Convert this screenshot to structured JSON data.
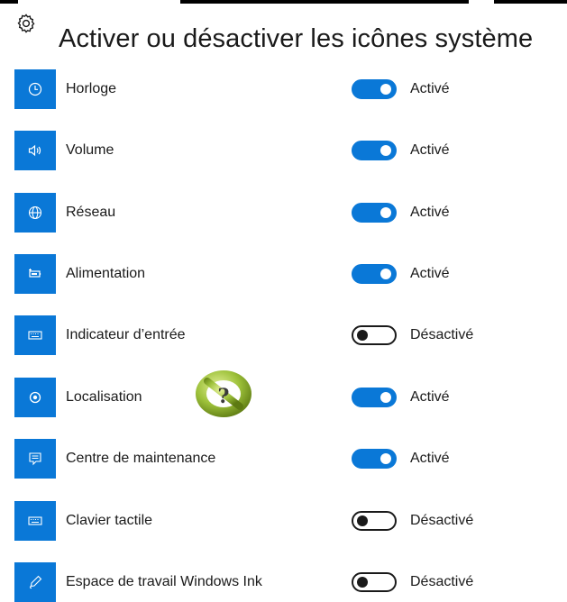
{
  "header": {
    "title": "Activer ou désactiver les icônes système",
    "icon": "gear-icon"
  },
  "items": [
    {
      "label": "Horloge",
      "icon": "clock-icon",
      "state_label": "Activé",
      "on": true
    },
    {
      "label": "Volume",
      "icon": "speaker-icon",
      "state_label": "Activé",
      "on": true
    },
    {
      "label": "Réseau",
      "icon": "globe-icon",
      "state_label": "Activé",
      "on": true
    },
    {
      "label": "Alimentation",
      "icon": "battery-icon",
      "state_label": "Activé",
      "on": true
    },
    {
      "label": "Indicateur d’entrée",
      "icon": "keyboard-icon",
      "state_label": "Désactivé",
      "on": false
    },
    {
      "label": "Localisation",
      "icon": "location-icon",
      "state_label": "Activé",
      "on": true
    },
    {
      "label": "Centre de maintenance",
      "icon": "action-center-icon",
      "state_label": "Activé",
      "on": true
    },
    {
      "label": "Clavier tactile",
      "icon": "touch-keyboard-icon",
      "state_label": "Désactivé",
      "on": false
    },
    {
      "label": "Espace de travail Windows Ink",
      "icon": "pen-icon",
      "state_label": "Désactivé",
      "on": false
    }
  ],
  "overlay": {
    "icon": "no-help-badge-icon",
    "glyph": "?"
  },
  "colors": {
    "accent": "#0a78d7",
    "text": "#1a1a1a",
    "background": "#ffffff",
    "badge_green": "#9dc13a"
  }
}
